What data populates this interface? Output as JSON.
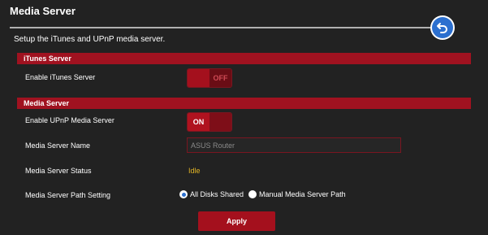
{
  "header": {
    "title": "Media Server",
    "back_icon": "back-arrow-icon"
  },
  "subtitle": "Setup the iTunes and UPnP media server.",
  "itunes_section": {
    "title": "iTunes Server",
    "enable_label": "Enable iTunes Server",
    "toggle_text": "OFF",
    "toggle_state": "off"
  },
  "media_section": {
    "title": "Media Server",
    "upnp_label": "Enable UPnP Media Server",
    "upnp_toggle_text": "ON",
    "upnp_toggle_state": "on",
    "name_label": "Media Server Name",
    "name_value": "ASUS Router",
    "status_label": "Media Server Status",
    "status_value": "Idle",
    "path_label": "Media Server Path Setting",
    "path_options": [
      "All Disks Shared",
      "Manual Media Server Path"
    ],
    "path_selected": "All Disks Shared"
  },
  "apply_label": "Apply",
  "colors": {
    "accent_red": "#a4101d",
    "status_yellow": "#e2b526",
    "radio_blue": "#2b6fcf"
  }
}
